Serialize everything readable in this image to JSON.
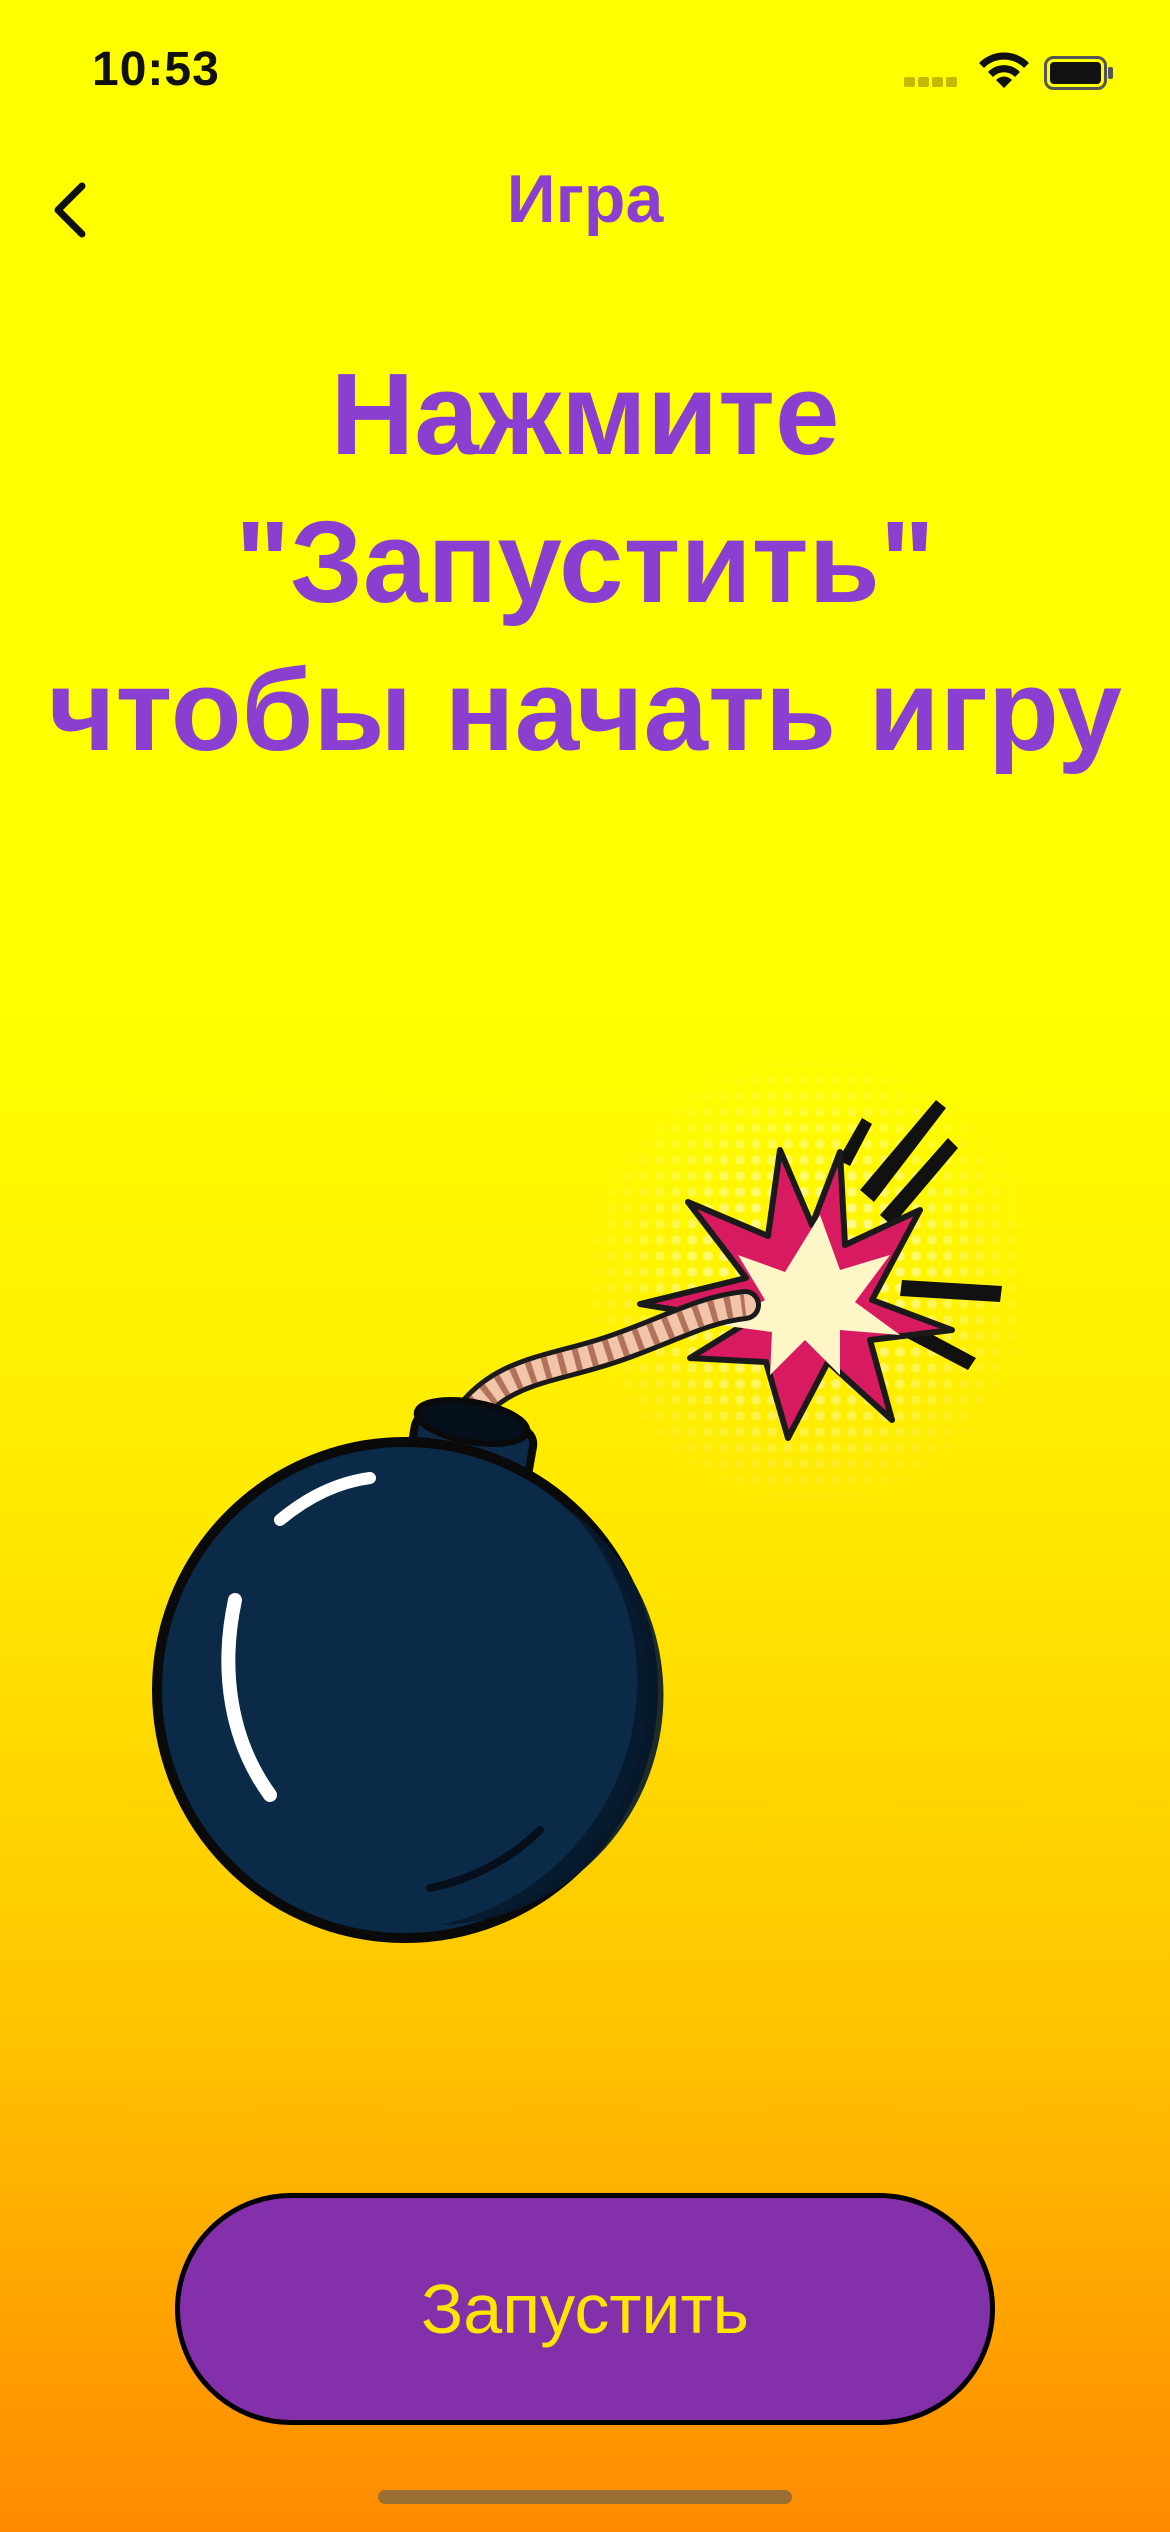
{
  "status_bar": {
    "time": "10:53"
  },
  "nav": {
    "title": "Игра",
    "back_icon": "chevron-left-icon"
  },
  "instruction": {
    "text": "Нажмите \"Запустить\" чтобы начать игру"
  },
  "illustration": {
    "name": "bomb-with-lit-fuse"
  },
  "start_button": {
    "label": "Запустить"
  },
  "colors": {
    "accent": "#8a3fd1",
    "button_bg": "#8330aa",
    "button_text": "#ffe600",
    "background_top": "#ffff00",
    "background_bottom": "#ff8a00"
  }
}
